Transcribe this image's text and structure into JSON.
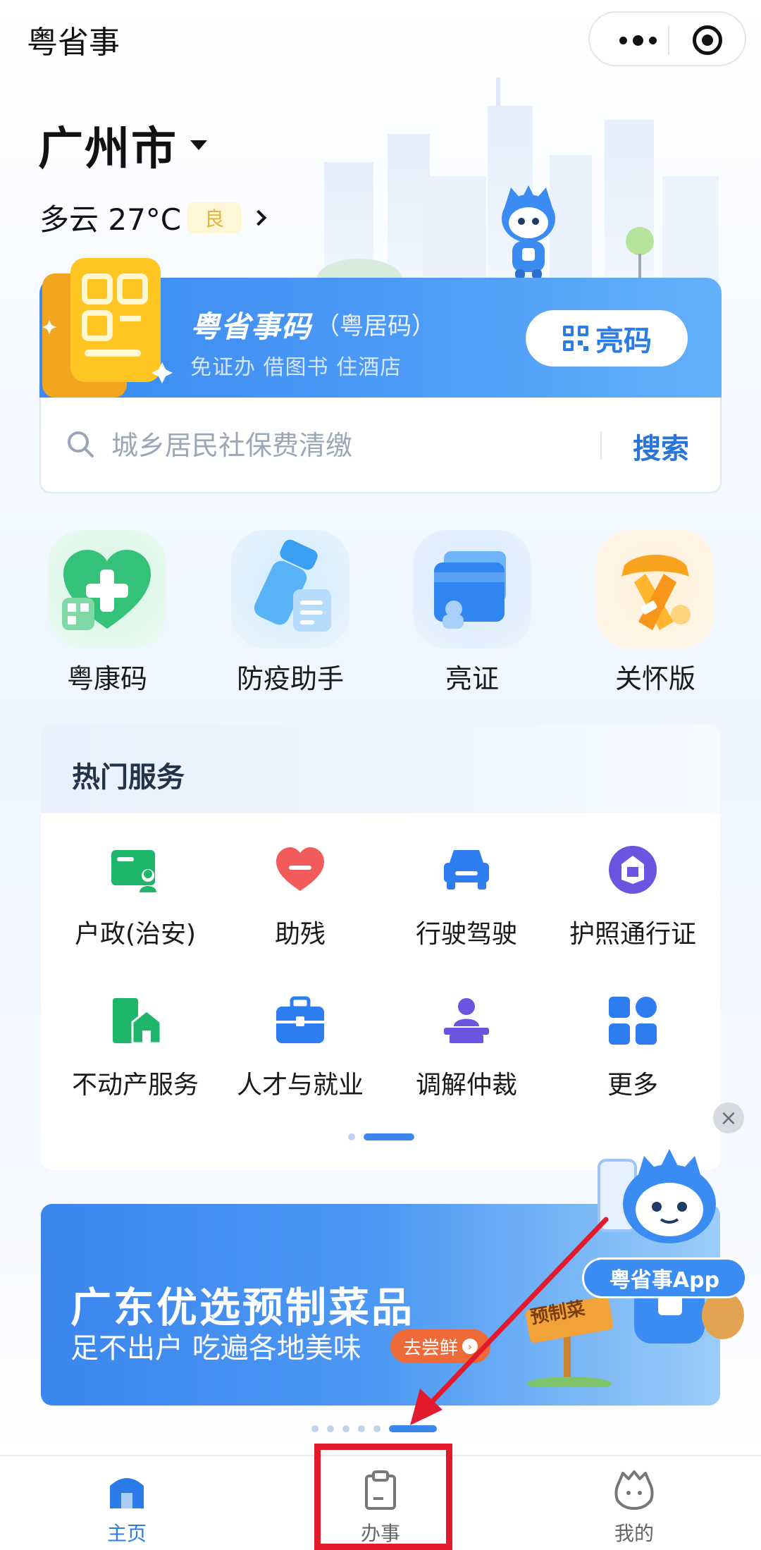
{
  "header": {
    "app_title": "粤省事"
  },
  "location": {
    "city": "广州市",
    "weather": "多云 27°C",
    "air_quality": "良"
  },
  "code_card": {
    "title": "粤省事码",
    "subtitle": "（粤居码）",
    "description": "免证办 借图书 住酒店",
    "show_button": "亮码"
  },
  "search": {
    "placeholder": "城乡居民社保费清缴",
    "button": "搜索"
  },
  "quick_actions": [
    {
      "label": "粤康码",
      "icon": "health-code-icon"
    },
    {
      "label": "防疫助手",
      "icon": "epidemic-assistant-icon"
    },
    {
      "label": "亮证",
      "icon": "show-certificate-icon"
    },
    {
      "label": "关怀版",
      "icon": "care-version-icon"
    }
  ],
  "hot_services": {
    "title": "热门服务",
    "items": [
      {
        "label": "户政(治安)",
        "icon": "household-icon"
      },
      {
        "label": "助残",
        "icon": "disability-aid-icon"
      },
      {
        "label": "行驶驾驶",
        "icon": "car-icon"
      },
      {
        "label": "护照通行证",
        "icon": "passport-icon"
      },
      {
        "label": "不动产服务",
        "icon": "real-estate-icon"
      },
      {
        "label": "人才与就业",
        "icon": "briefcase-icon"
      },
      {
        "label": "调解仲裁",
        "icon": "mediation-icon"
      },
      {
        "label": "更多",
        "icon": "more-grid-icon"
      }
    ]
  },
  "banner": {
    "title": "广东优选预制菜品",
    "subtitle": "足不出户 吃遍各地美味",
    "cta": "去尝鲜",
    "sign_text": "预制菜"
  },
  "floating": {
    "badge": "粤省事App",
    "close": "×"
  },
  "bottom_nav": [
    {
      "label": "主页",
      "icon": "home-icon",
      "active": true
    },
    {
      "label": "办事",
      "icon": "clipboard-icon",
      "active": false
    },
    {
      "label": "我的",
      "icon": "profile-icon",
      "active": false
    }
  ],
  "colors": {
    "primary": "#2b7be8",
    "annotation": "#e21a2b",
    "banner_cta": "#ee6a38"
  }
}
